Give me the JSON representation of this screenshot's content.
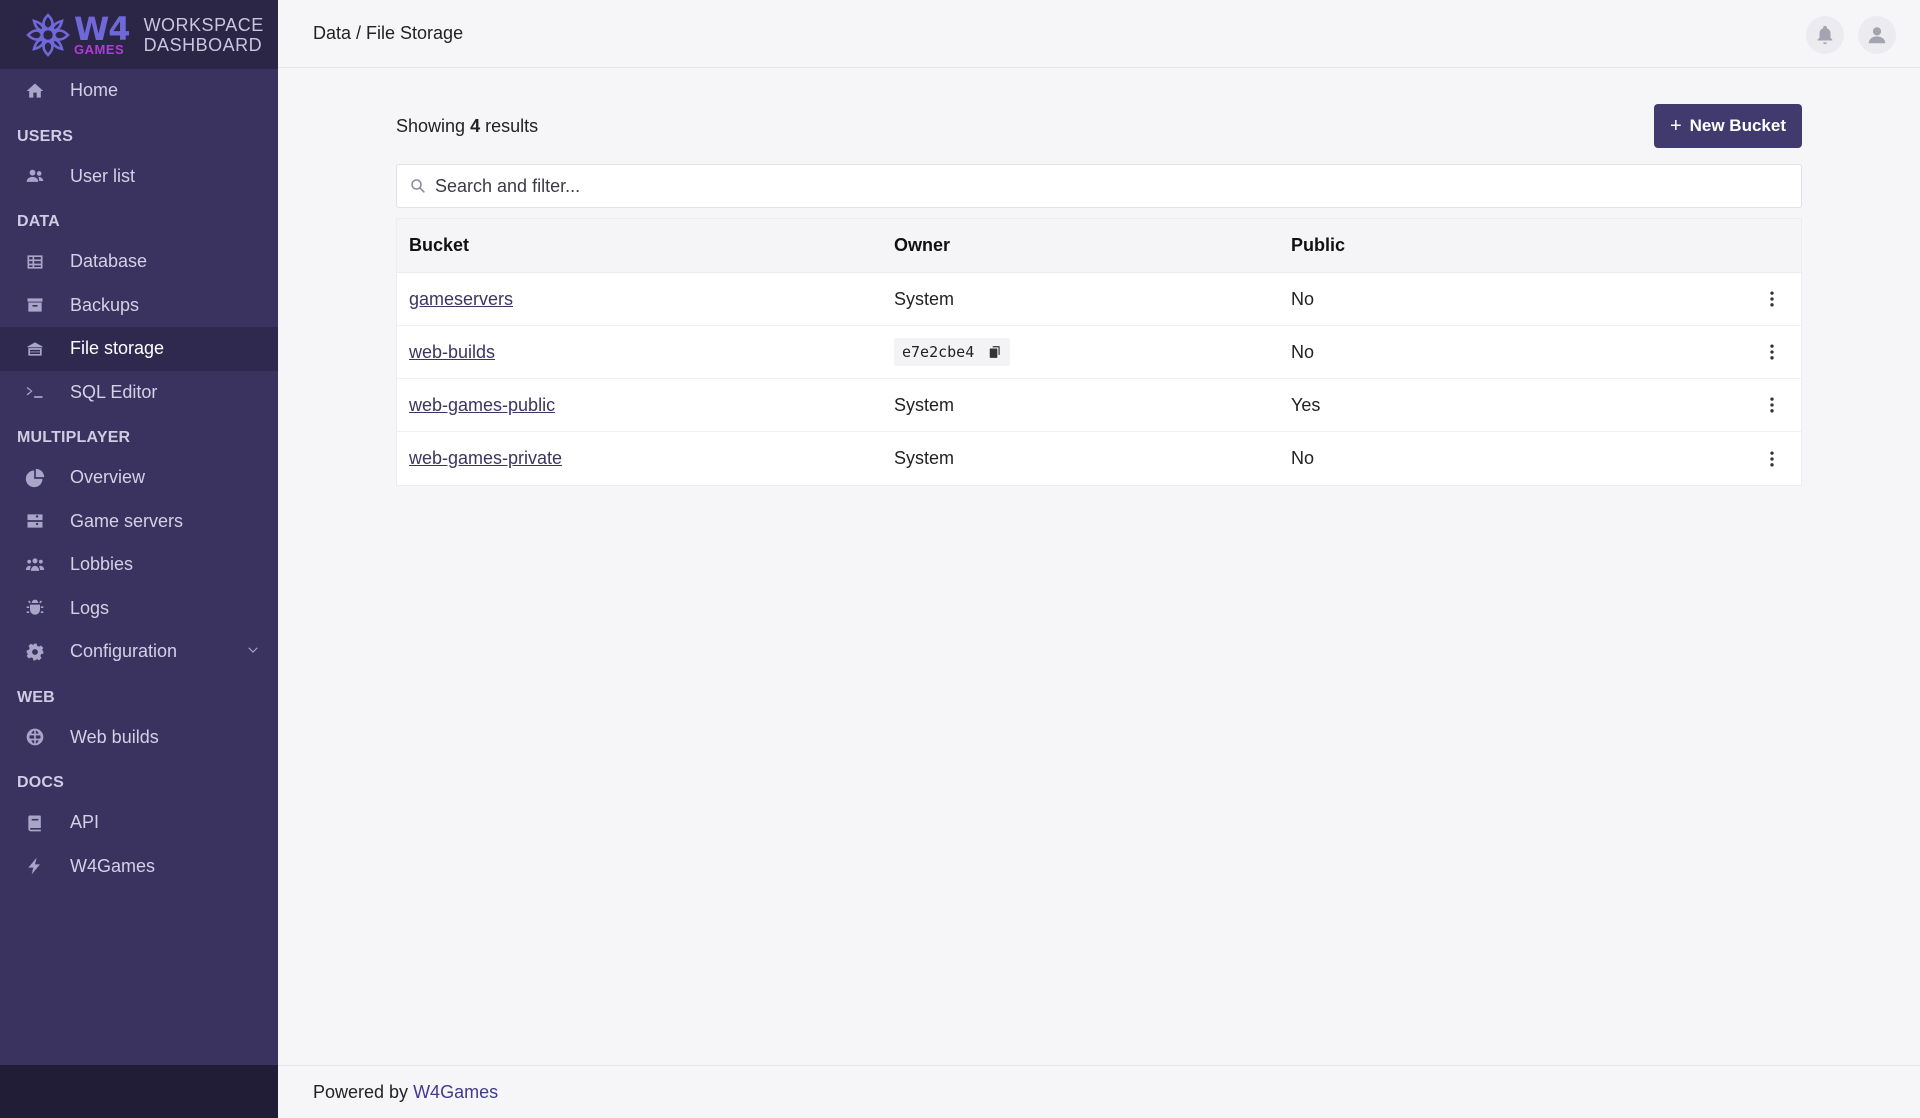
{
  "brand": {
    "logo_text": "W4",
    "logo_subtext": "GAMES",
    "title_line1": "WORKSPACE",
    "title_line2": "DASHBOARD",
    "accent_color": "#6f68d8",
    "sub_color": "#b43bd6"
  },
  "sidebar": {
    "home": {
      "label": "Home",
      "icon": "home-icon"
    },
    "sections": [
      {
        "title": "USERS",
        "items": [
          {
            "label": "User list",
            "icon": "users-icon"
          }
        ]
      },
      {
        "title": "DATA",
        "items": [
          {
            "label": "Database",
            "icon": "table-icon"
          },
          {
            "label": "Backups",
            "icon": "archive-icon"
          },
          {
            "label": "File storage",
            "icon": "storage-icon",
            "active": true
          },
          {
            "label": "SQL Editor",
            "icon": "terminal-icon"
          }
        ]
      },
      {
        "title": "MULTIPLAYER",
        "items": [
          {
            "label": "Overview",
            "icon": "pie-icon"
          },
          {
            "label": "Game servers",
            "icon": "server-icon"
          },
          {
            "label": "Lobbies",
            "icon": "group-icon"
          },
          {
            "label": "Logs",
            "icon": "bug-icon"
          },
          {
            "label": "Configuration",
            "icon": "gear-icon",
            "expandable": true
          }
        ]
      },
      {
        "title": "WEB",
        "items": [
          {
            "label": "Web builds",
            "icon": "globe-icon"
          }
        ]
      },
      {
        "title": "DOCS",
        "items": [
          {
            "label": "API",
            "icon": "book-icon"
          },
          {
            "label": "W4Games",
            "icon": "bolt-icon"
          }
        ]
      }
    ]
  },
  "header": {
    "breadcrumb": "Data / File Storage"
  },
  "main": {
    "results_prefix": "Showing",
    "results_count": "4",
    "results_suffix": "results",
    "new_button_label": "New Bucket",
    "search_placeholder": "Search and filter...",
    "table": {
      "columns": [
        "Bucket",
        "Owner",
        "Public"
      ],
      "rows": [
        {
          "bucket": "gameservers",
          "owner": "System",
          "owner_is_code": false,
          "public": "No"
        },
        {
          "bucket": "web-builds",
          "owner": "e7e2cbe4",
          "owner_is_code": true,
          "public": "No"
        },
        {
          "bucket": "web-games-public",
          "owner": "System",
          "owner_is_code": false,
          "public": "Yes"
        },
        {
          "bucket": "web-games-private",
          "owner": "System",
          "owner_is_code": false,
          "public": "No"
        }
      ]
    }
  },
  "footer": {
    "prefix": "Powered by",
    "link": "W4Games"
  }
}
